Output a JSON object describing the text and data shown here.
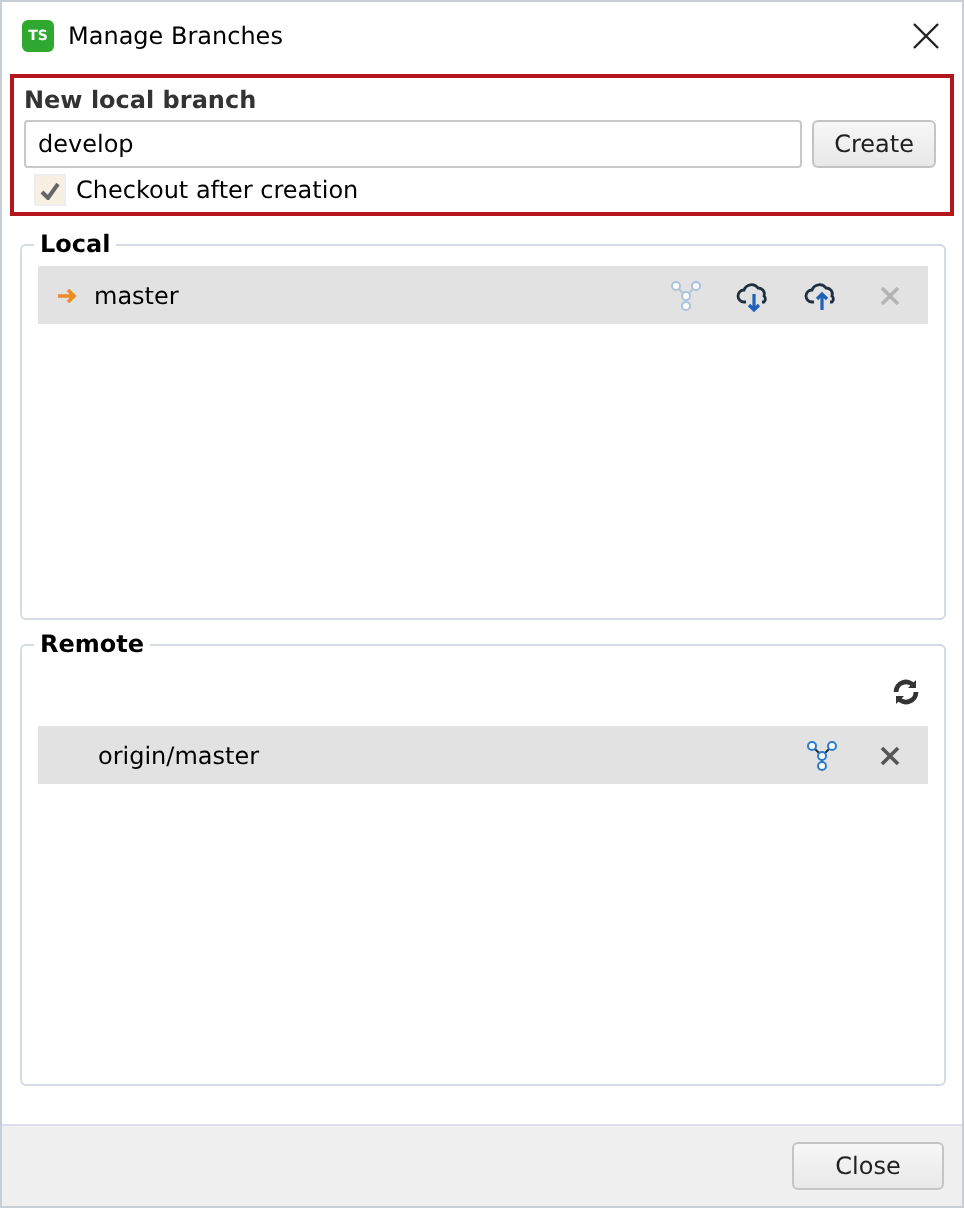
{
  "window": {
    "title": "Manage Branches",
    "app_badge": "TS"
  },
  "new_branch": {
    "label": "New local branch",
    "value": "develop",
    "create_button": "Create",
    "checkout": {
      "label": "Checkout after creation",
      "checked": true
    }
  },
  "local": {
    "title": "Local",
    "branches": [
      {
        "name": "master",
        "current": true,
        "actions": [
          {
            "kind": "merge",
            "disabled": true
          },
          {
            "kind": "pull",
            "disabled": false
          },
          {
            "kind": "push",
            "disabled": false
          },
          {
            "kind": "delete",
            "disabled": true
          }
        ]
      }
    ]
  },
  "remote": {
    "title": "Remote",
    "branches": [
      {
        "name": "origin/master",
        "current": false,
        "actions": [
          {
            "kind": "merge",
            "disabled": false
          },
          {
            "kind": "delete",
            "disabled": false
          }
        ]
      }
    ]
  },
  "footer": {
    "close_button": "Close"
  }
}
